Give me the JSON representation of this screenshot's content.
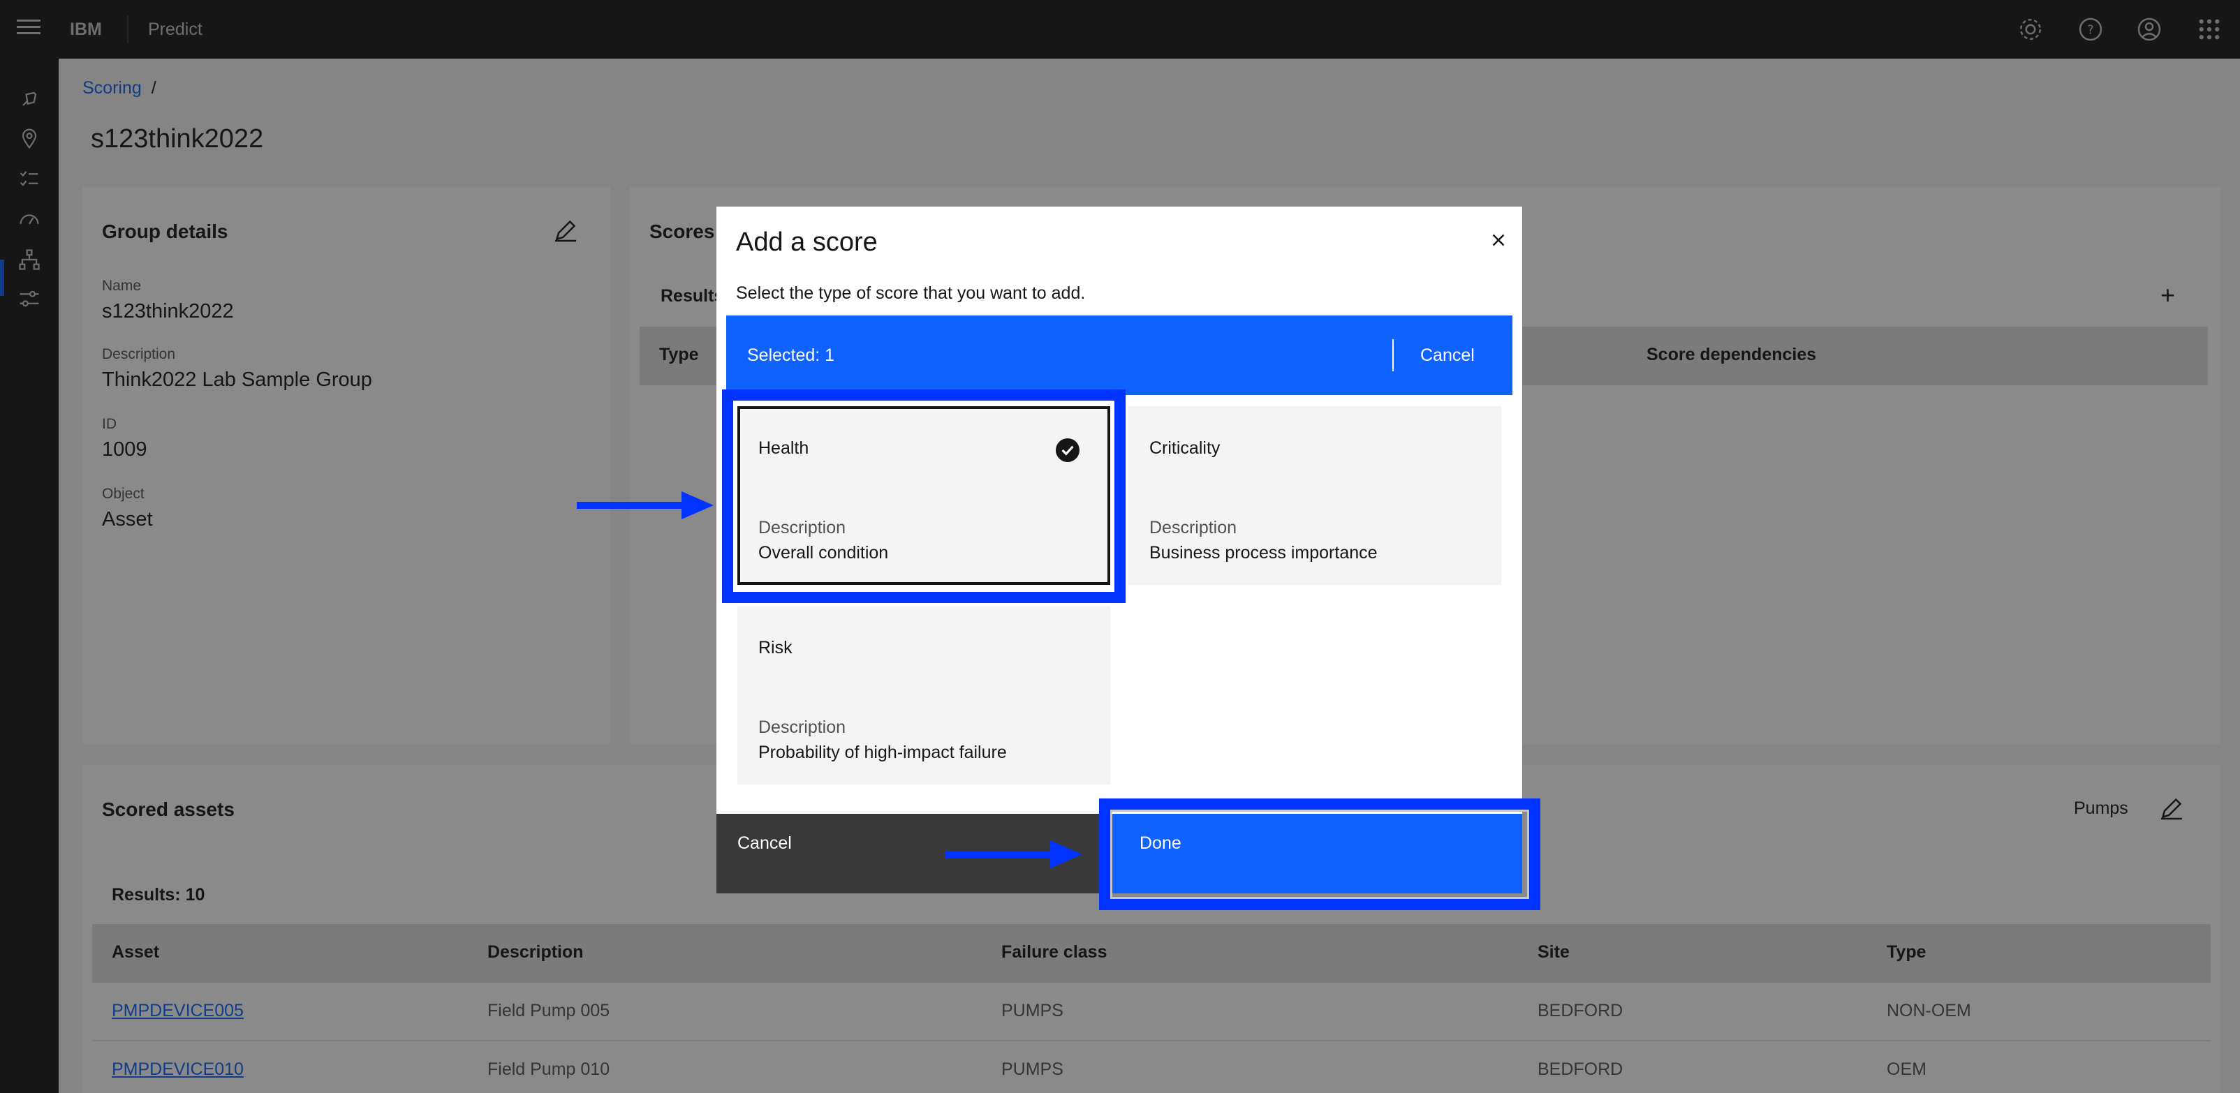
{
  "header": {
    "brand": "IBM",
    "product": "Predict",
    "icons": [
      "menu-icon",
      "settings-icon",
      "help-icon",
      "user-icon",
      "app-switcher-icon"
    ]
  },
  "rail": {
    "icons": [
      "rocket-icon",
      "location-icon",
      "checklist-icon",
      "gauge-icon",
      "hierarchy-icon",
      "sliders-icon"
    ]
  },
  "breadcrumb": {
    "link": "Scoring",
    "separator": "/"
  },
  "page_title": "s123think2022",
  "group_details": {
    "title": "Group details",
    "fields": [
      {
        "label": "Name",
        "value": "s123think2022"
      },
      {
        "label": "Description",
        "value": "Think2022 Lab Sample Group"
      },
      {
        "label": "ID",
        "value": "1009"
      },
      {
        "label": "Object",
        "value": "Asset"
      }
    ]
  },
  "scores_panel": {
    "title": "Scores",
    "results": "Results",
    "col_type": "Type",
    "col_deps": "Score dependencies"
  },
  "scored_assets": {
    "title": "Scored assets",
    "filter": "Pumps",
    "results": "Results: 10",
    "columns": [
      "Asset",
      "Description",
      "Failure class",
      "Site",
      "Type"
    ],
    "rows": [
      [
        "PMPDEVICE005",
        "Field Pump 005",
        "PUMPS",
        "BEDFORD",
        "NON-OEM"
      ],
      [
        "PMPDEVICE010",
        "Field Pump 010",
        "PUMPS",
        "BEDFORD",
        "OEM"
      ]
    ]
  },
  "modal": {
    "title": "Add a score",
    "subtitle": "Select the type of score that you want to add.",
    "selected_text": "Selected: 1",
    "selbar_cancel": "Cancel",
    "cards": [
      {
        "title": "Health",
        "desc_label": "Description",
        "desc": "Overall condition",
        "selected": true
      },
      {
        "title": "Criticality",
        "desc_label": "Description",
        "desc": "Business process importance",
        "selected": false
      },
      {
        "title": "Risk",
        "desc_label": "Description",
        "desc": "Probability of high-impact failure",
        "selected": false
      }
    ],
    "footer_cancel": "Cancel",
    "footer_done": "Done"
  },
  "colors": {
    "accent": "#0f62fe",
    "annotation": "#0033ff",
    "header_bg": "#161616"
  }
}
